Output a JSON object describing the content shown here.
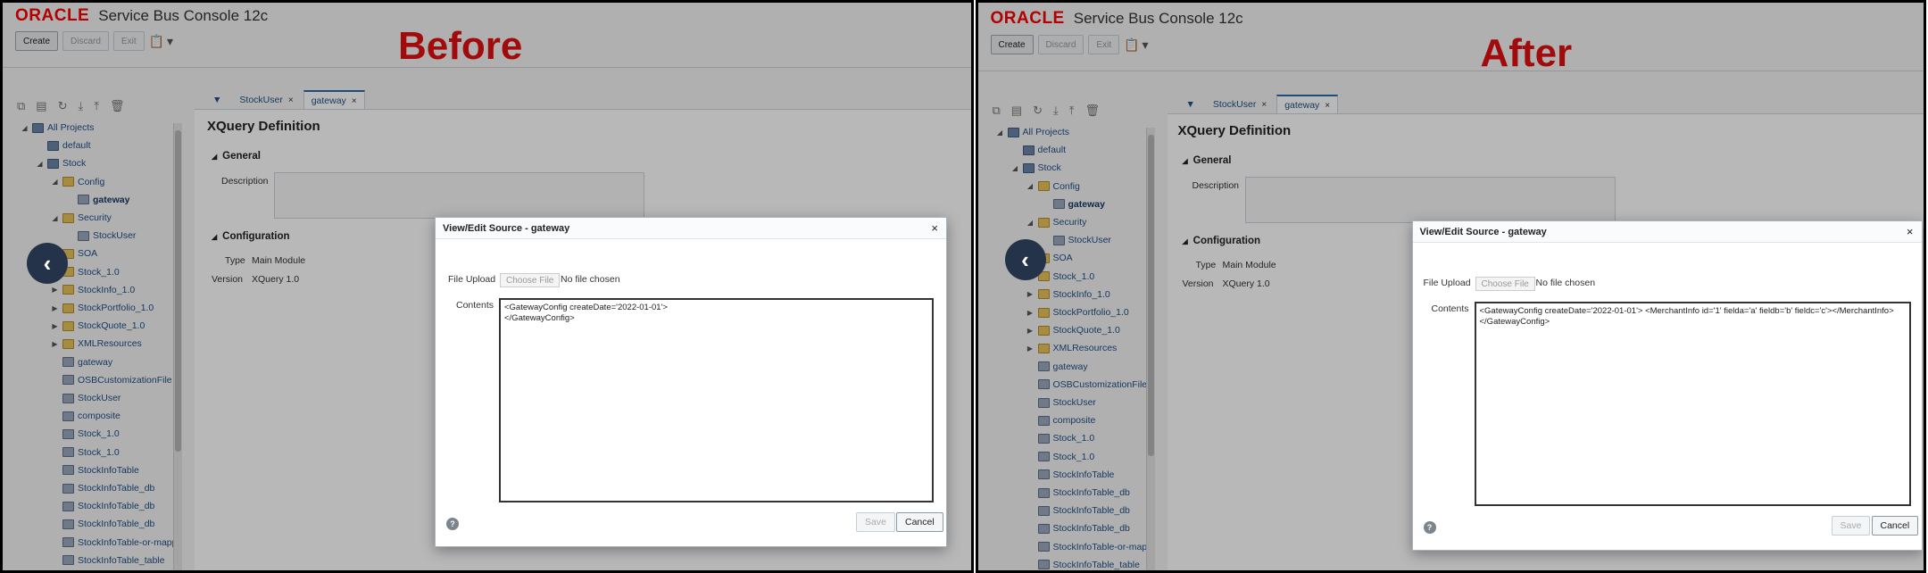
{
  "app": {
    "logo": "ORACLE",
    "title": "Service Bus Console 12c"
  },
  "toolbar": {
    "create": "Create",
    "discard": "Discard",
    "exit": "Exit",
    "clipboard": "📋",
    "dropdown": "▾"
  },
  "captions": {
    "before": "Before",
    "after": "After"
  },
  "tree_tools": [
    "⧉",
    "▤",
    "↻",
    "⤓",
    "⤒",
    "🗑"
  ],
  "tree": [
    {
      "label": "All Projects",
      "icon": "proj",
      "toggle": "◢",
      "depth": 0
    },
    {
      "label": "default",
      "icon": "proj",
      "toggle": "",
      "depth": 1
    },
    {
      "label": "Stock",
      "icon": "proj",
      "toggle": "◢",
      "depth": 1
    },
    {
      "label": "Config",
      "icon": "fold",
      "toggle": "◢",
      "depth": 2
    },
    {
      "label": "gateway",
      "icon": "res",
      "toggle": "",
      "depth": 3,
      "active": true
    },
    {
      "label": "Security",
      "icon": "fold",
      "toggle": "◢",
      "depth": 2
    },
    {
      "label": "StockUser",
      "icon": "res",
      "toggle": "",
      "depth": 3
    },
    {
      "label": "SOA",
      "icon": "fold",
      "toggle": "",
      "depth": 2
    },
    {
      "label": "Stock_1.0",
      "icon": "fold",
      "toggle": "",
      "depth": 2
    },
    {
      "label": "StockInfo_1.0",
      "icon": "fold",
      "toggle": "▶",
      "depth": 2
    },
    {
      "label": "StockPortfolio_1.0",
      "icon": "fold",
      "toggle": "▶",
      "depth": 2
    },
    {
      "label": "StockQuote_1.0",
      "icon": "fold",
      "toggle": "▶",
      "depth": 2
    },
    {
      "label": "XMLResources",
      "icon": "fold",
      "toggle": "▶",
      "depth": 2
    },
    {
      "label": "gateway",
      "icon": "res",
      "toggle": "",
      "depth": 2
    },
    {
      "label": "OSBCustomizationFile",
      "icon": "res",
      "toggle": "",
      "depth": 2
    },
    {
      "label": "StockUser",
      "icon": "res",
      "toggle": "",
      "depth": 2
    },
    {
      "label": "composite",
      "icon": "res",
      "toggle": "",
      "depth": 2
    },
    {
      "label": "Stock_1.0",
      "icon": "res",
      "toggle": "",
      "depth": 2
    },
    {
      "label": "Stock_1.0",
      "icon": "res",
      "toggle": "",
      "depth": 2
    },
    {
      "label": "StockInfoTable",
      "icon": "res",
      "toggle": "",
      "depth": 2
    },
    {
      "label": "StockInfoTable_db",
      "icon": "res",
      "toggle": "",
      "depth": 2
    },
    {
      "label": "StockInfoTable_db",
      "icon": "res",
      "toggle": "",
      "depth": 2
    },
    {
      "label": "StockInfoTable_db",
      "icon": "res",
      "toggle": "",
      "depth": 2
    },
    {
      "label": "StockInfoTable-or-mappi",
      "icon": "res",
      "toggle": "",
      "depth": 2
    },
    {
      "label": "StockInfoTable_table",
      "icon": "res",
      "toggle": "",
      "depth": 2
    }
  ],
  "tabs": [
    {
      "label": "StockUser",
      "close": "×"
    },
    {
      "label": "gateway",
      "close": "×"
    }
  ],
  "tab_menu": "▼",
  "editor": {
    "heading": "XQuery Definition",
    "general": "General",
    "description_label": "Description",
    "configuration": "Configuration",
    "type_label": "Type",
    "type_value": "Main Module",
    "version_label": "Version",
    "version_value": "XQuery 1.0",
    "collapse": "◢"
  },
  "dialog": {
    "title": "View/Edit Source - gateway",
    "close": "×",
    "file_upload_label": "File Upload",
    "choose_file": "Choose File",
    "no_file": "No file chosen",
    "contents_label": "Contents",
    "help": "?",
    "save": "Save",
    "cancel": "Cancel"
  },
  "contents_before": "<GatewayConfig createDate='2022-01-01'>\n</GatewayConfig>",
  "contents_after": "<GatewayConfig createDate='2022-01-01'> <MerchantInfo id='1' fielda='a' fieldb='b' fieldc='c'></MerchantInfo>\n</GatewayConfig>",
  "back_icon": "‹"
}
